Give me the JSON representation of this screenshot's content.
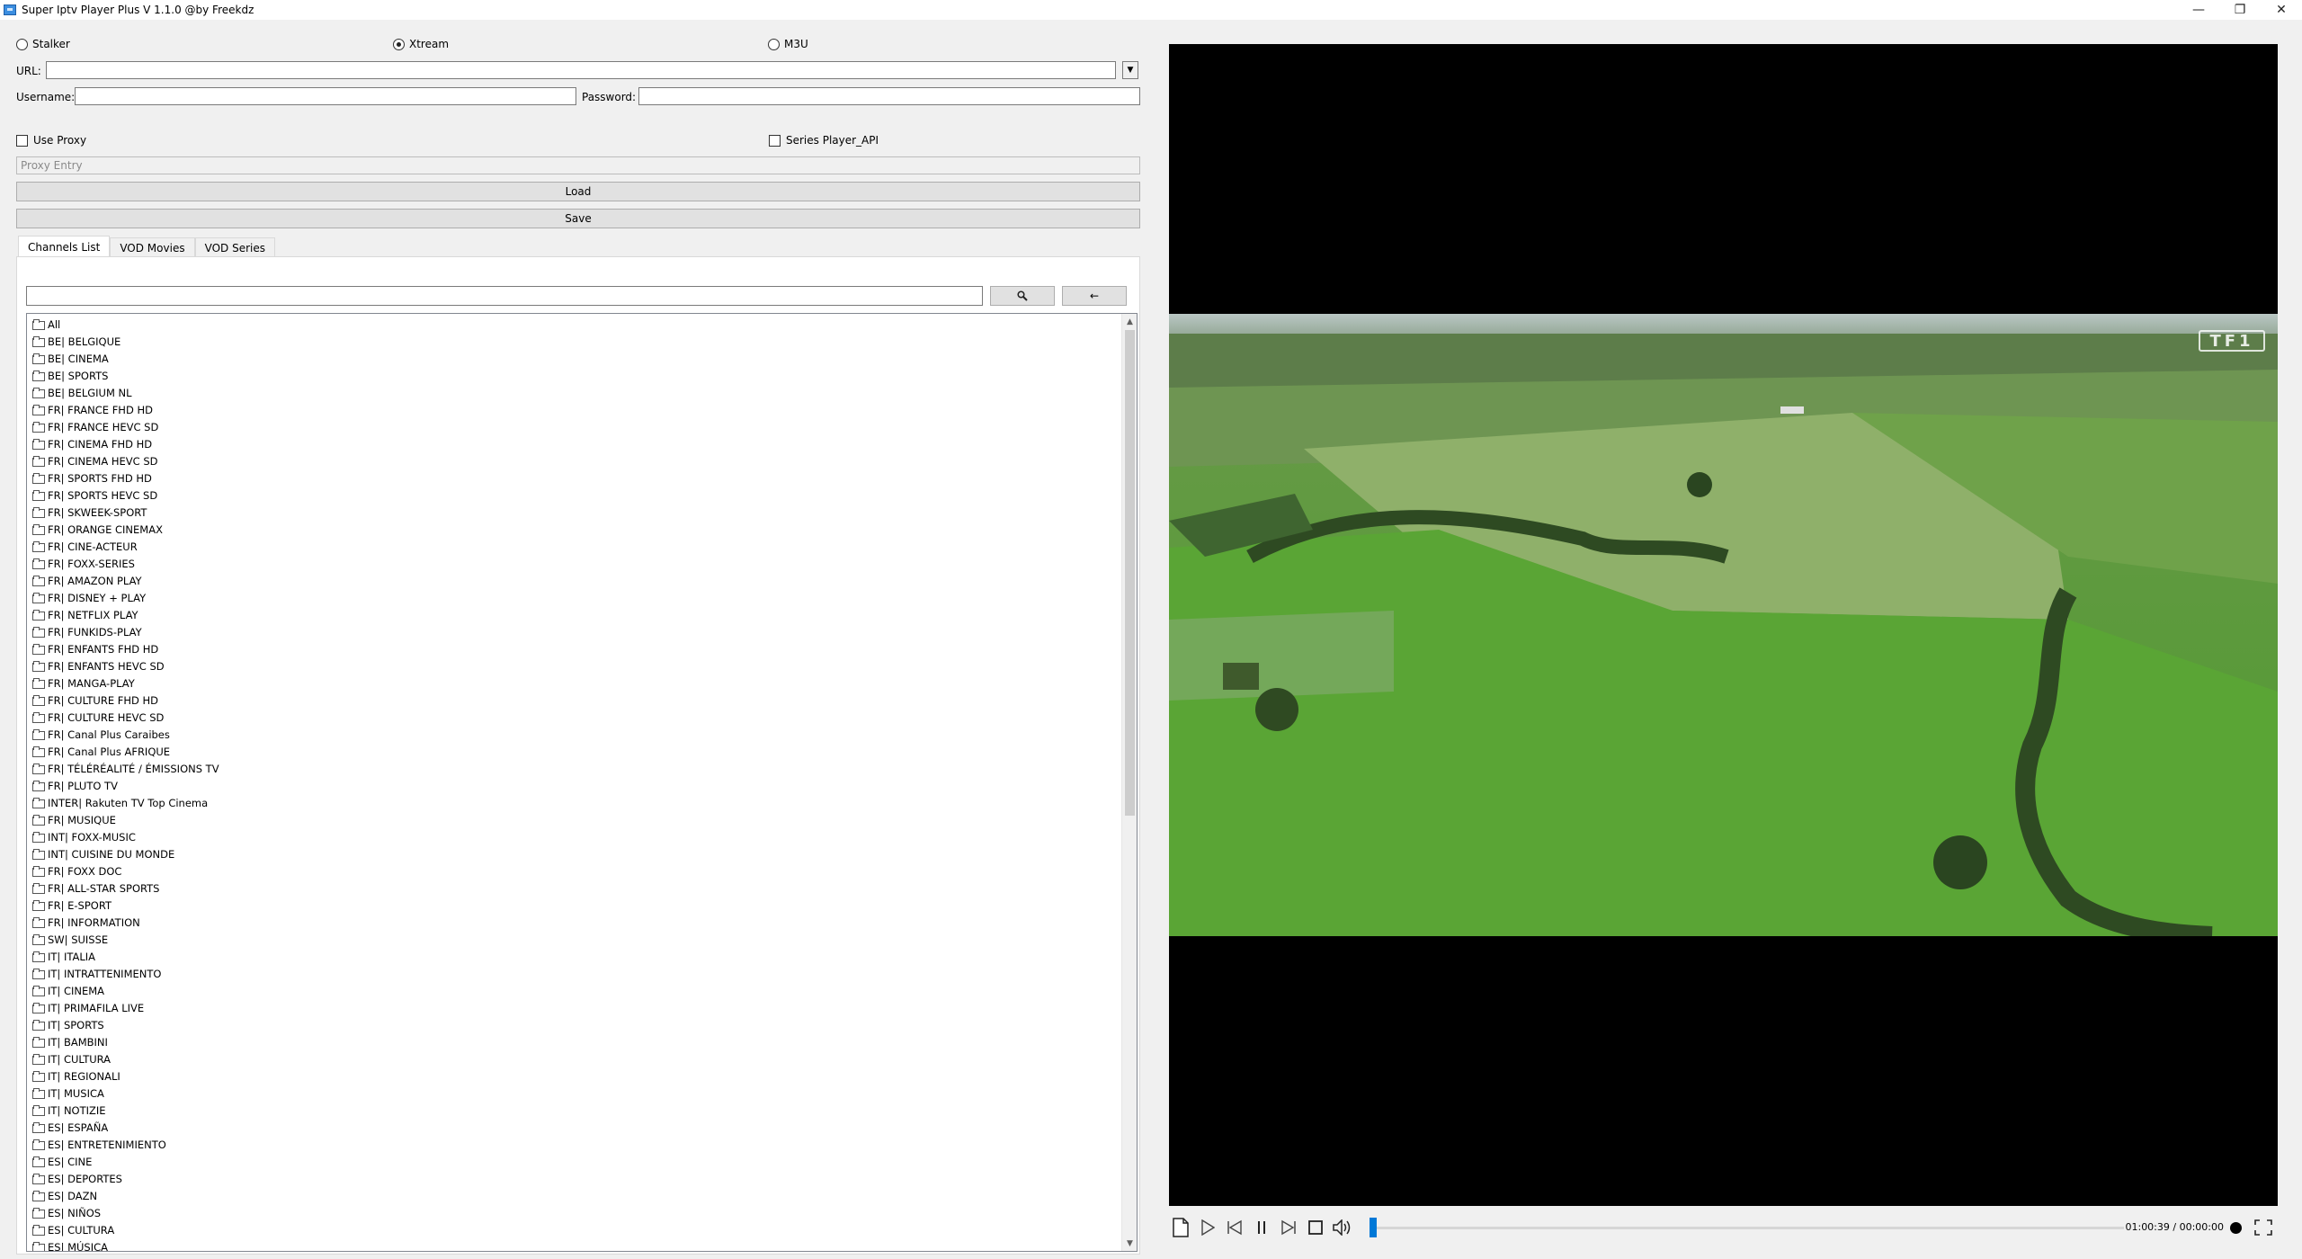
{
  "window": {
    "title": "Super Iptv Player Plus V 1.1.0 @by Freekdz",
    "minimize": "—",
    "restore": "❐",
    "close": "✕"
  },
  "source_type": {
    "options": [
      "Stalker",
      "Xtream",
      "M3U"
    ],
    "selected": "Xtream"
  },
  "form": {
    "url_label": "URL:",
    "url_value": "",
    "username_label": "Username:",
    "username_value": "",
    "password_label": "Password:",
    "password_value": "",
    "use_proxy_label": "Use Proxy",
    "series_api_label": "Series Player_API",
    "proxy_placeholder": "Proxy Entry",
    "load_label": "Load",
    "save_label": "Save"
  },
  "tabs": [
    "Channels List",
    "VOD Movies",
    "VOD Series"
  ],
  "active_tab": "Channels List",
  "search": {
    "value": "",
    "search_icon": "magnifier-icon",
    "back_label": "←"
  },
  "channels": [
    "All",
    "BE| BELGIQUE",
    "BE| CINEMA",
    "BE| SPORTS",
    "BE| BELGIUM NL",
    "FR| FRANCE FHD HD",
    "FR| FRANCE HEVC SD",
    "FR| CINEMA FHD HD",
    "FR| CINEMA HEVC SD",
    "FR| SPORTS FHD HD",
    "FR| SPORTS HEVC SD",
    "FR| SKWEEK-SPORT",
    "FR| ORANGE CINEMAX",
    "FR| CINE-ACTEUR",
    "FR| FOXX-SERIES",
    "FR| AMAZON  PLAY",
    "FR| DISNEY + PLAY",
    "FR| NETFLIX PLAY",
    "FR| FUNKIDS-PLAY",
    "FR| ENFANTS FHD HD",
    "FR| ENFANTS  HEVC SD",
    "FR| MANGA-PLAY",
    "FR| CULTURE FHD HD",
    "FR| CULTURE HEVC SD",
    "FR| Canal Plus Caraibes",
    "FR| Canal Plus AFRIQUE",
    "FR| TÉLÉRÉALITÉ / ÉMISSIONS TV",
    "FR| PLUTO TV",
    "INTER| Rakuten TV Top Cinema",
    "FR| MUSIQUE",
    "INT| FOXX-MUSIC",
    "INT| CUISINE DU MONDE",
    "FR| FOXX DOC",
    "FR| ALL-STAR SPORTS",
    "FR| E-SPORT",
    "FR| INFORMATION",
    "SW| SUISSE",
    "IT| ITALIA",
    "IT| INTRATTENIMENTO",
    "IT| CINEMA",
    "IT| PRIMAFILA LIVE",
    "IT| SPORTS",
    "IT| BAMBINI",
    "IT| CULTURA",
    "IT| REGIONALI",
    "IT| MUSICA",
    "IT| NOTIZIE",
    "ES| ESPAÑA",
    "ES| ENTRETENIMIENTO",
    "ES| CINE",
    "ES| DEPORTES",
    "ES| DAZN",
    "ES| NIÑOS",
    "ES| CULTURA",
    "ES| MÚSICA"
  ],
  "player": {
    "channel_logo": "TF1",
    "time": "01:00:39 / 00:00:00",
    "progress_fraction": 0.0,
    "controls": [
      "open-file-icon",
      "play-icon",
      "previous-icon",
      "pause-icon",
      "next-icon",
      "stop-icon",
      "volume-icon",
      "fullscreen-icon"
    ]
  }
}
